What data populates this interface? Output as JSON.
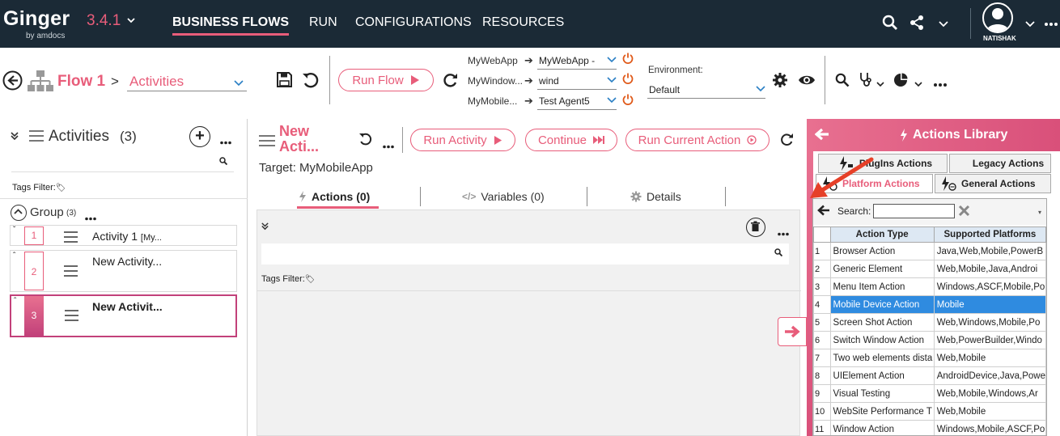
{
  "app": {
    "brand": "Ginger",
    "brand_sub": "by amdocs",
    "version": "3.4.1",
    "nav": [
      "BUSINESS FLOWS",
      "RUN",
      "CONFIGURATIONS",
      "RESOURCES"
    ],
    "username": "NATISHAK",
    "accent": "#e85d7a",
    "navbar_color": "#1b2a36"
  },
  "toolbar": {
    "flow_name": "Flow 1",
    "separator": ">",
    "view_select": "Activities",
    "run_flow": "Run Flow",
    "targets": [
      {
        "label": "MyWebApp",
        "agent": "MyWebApp -"
      },
      {
        "label": "MyWindow...",
        "agent": "wind"
      },
      {
        "label": "MyMobile...",
        "agent": "Test Agent5"
      }
    ],
    "env_label": "Environment:",
    "env_value": "Default"
  },
  "activities": {
    "title": "Activities",
    "count": "(3)",
    "tags_filter": "Tags Filter:",
    "group_name": "Group",
    "group_count": "(3)",
    "items": [
      {
        "num": "1",
        "name": "Activity 1",
        "suffix": "[My..."
      },
      {
        "num": "2",
        "name": "New Activity...",
        "suffix": ""
      },
      {
        "num": "3",
        "name": "New Activit...",
        "suffix": ""
      }
    ]
  },
  "activity": {
    "name_line1": "New",
    "name_line2": "Acti...",
    "target": "Target: MyMobileApp",
    "run_activity": "Run Activity",
    "continue": "Continue",
    "run_current": "Run Current Action",
    "tabs": [
      {
        "label": "Actions (0)",
        "icon": "bolt-icon"
      },
      {
        "label": "Variables (0)",
        "icon": "code-icon"
      },
      {
        "label": "Details",
        "icon": "gear-icon"
      }
    ],
    "tags_filter": "Tags Filter:"
  },
  "library": {
    "title": "Actions Library",
    "tabs": [
      "PlugIns Actions",
      "Legacy Actions",
      "Platform Actions",
      "General Actions"
    ],
    "search_label": "Search:",
    "columns": [
      "Action Type",
      "Supported Platforms"
    ],
    "rows": [
      {
        "n": "1",
        "type": "Browser Action",
        "platforms": "Java,Web,Mobile,PowerB"
      },
      {
        "n": "2",
        "type": "Generic Element",
        "platforms": "Web,Mobile,Java,Androi"
      },
      {
        "n": "3",
        "type": "Menu Item Action",
        "platforms": "Windows,ASCF,Mobile,Po"
      },
      {
        "n": "4",
        "type": "Mobile Device Action",
        "platforms": "Mobile"
      },
      {
        "n": "5",
        "type": "Screen Shot Action",
        "platforms": "Web,Windows,Mobile,Po"
      },
      {
        "n": "6",
        "type": "Switch Window Action",
        "platforms": "Web,PowerBuilder,Windo"
      },
      {
        "n": "7",
        "type": "Two web elements dista",
        "platforms": "Web,Mobile"
      },
      {
        "n": "8",
        "type": "UIElement Action",
        "platforms": "AndroidDevice,Java,Powe"
      },
      {
        "n": "9",
        "type": "Visual Testing",
        "platforms": "Web,Mobile,Windows,Ar"
      },
      {
        "n": "10",
        "type": "WebSite Performance T",
        "platforms": "Web,Mobile"
      },
      {
        "n": "11",
        "type": "Window Action",
        "platforms": "Windows,Mobile,ASCF,Po"
      }
    ],
    "selected_row": "4"
  }
}
